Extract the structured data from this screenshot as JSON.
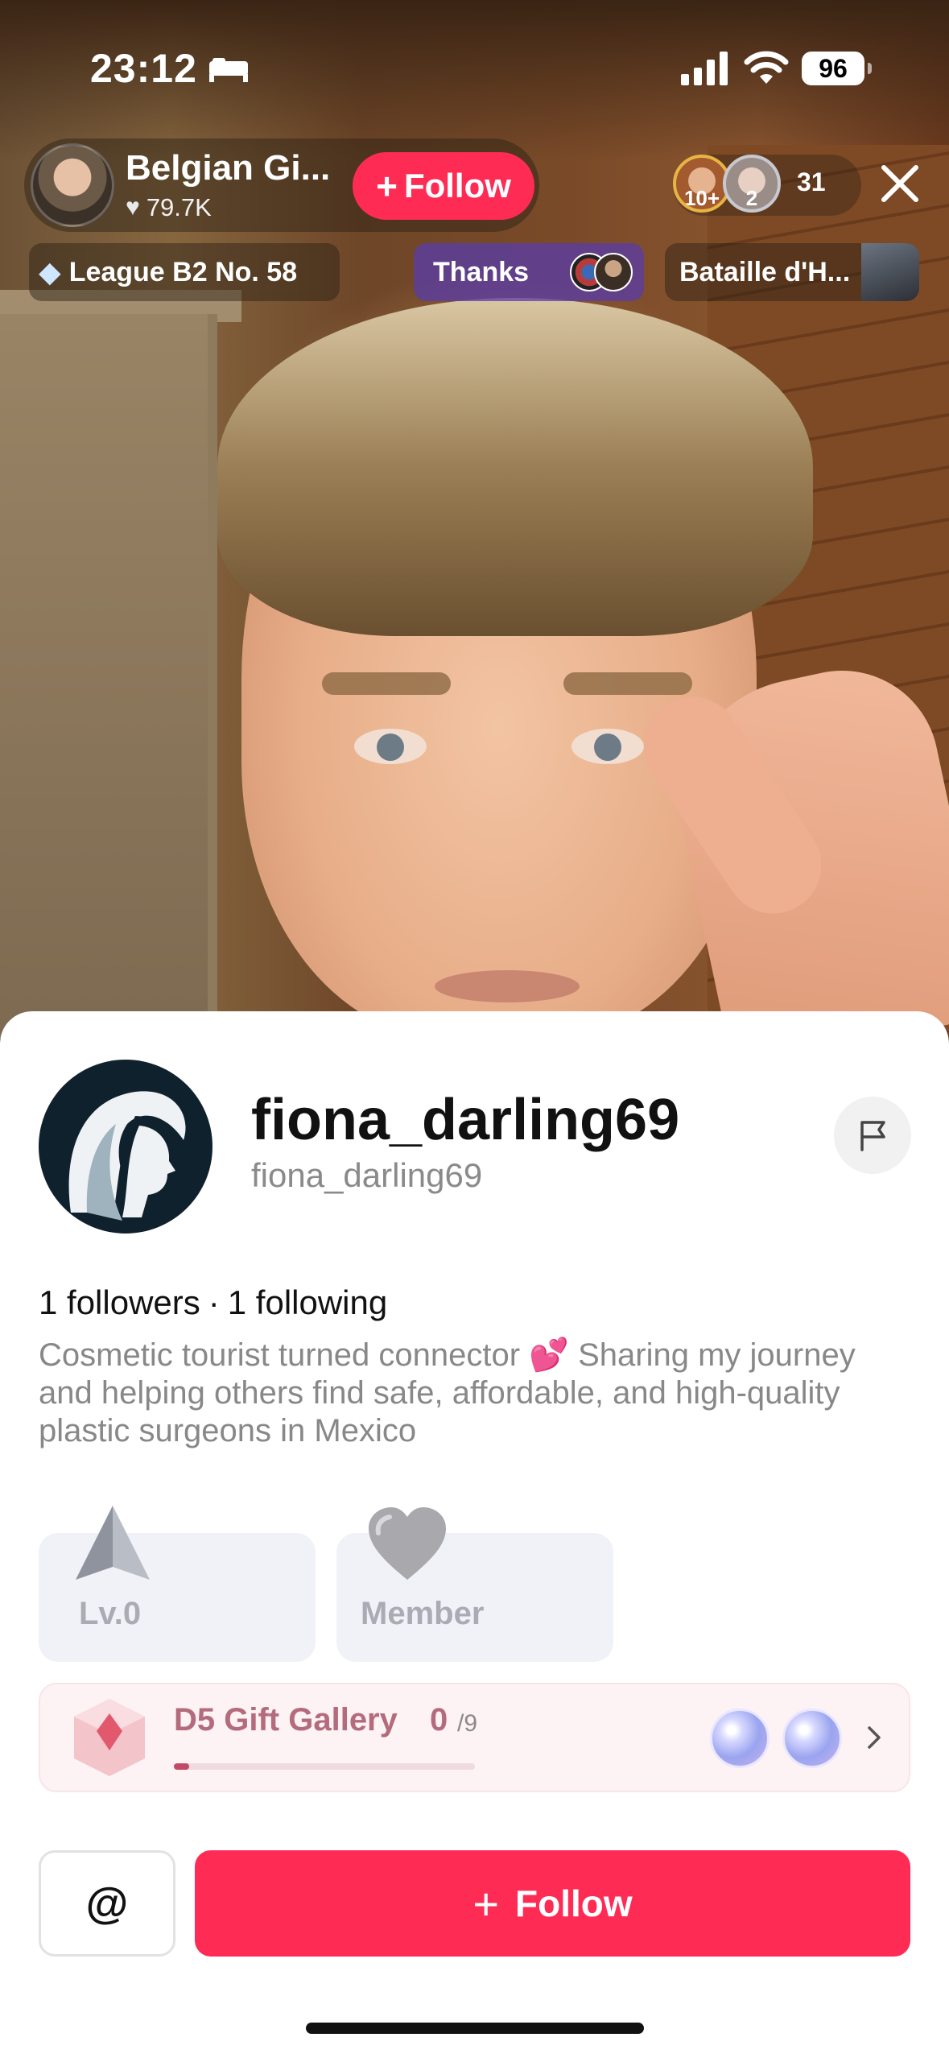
{
  "status_bar": {
    "time": "23:12",
    "battery": "96",
    "icons": [
      "sleep-focus-icon",
      "cellular-signal-icon",
      "wifi-icon",
      "battery-icon"
    ]
  },
  "live": {
    "host_name": "Belgian Gi...",
    "host_likes": "79.7K",
    "follow_label": "Follow",
    "viewer_badges": [
      "10+",
      "2"
    ],
    "viewer_count": "31",
    "league": "League B2 No. 58",
    "thanks": "Thanks",
    "battle": "Bataille d'H..."
  },
  "profile": {
    "username": "fiona_darling69",
    "handle": "fiona_darling69",
    "followers": "1 followers",
    "separator": "·",
    "following": "1 following",
    "bio": "Cosmetic tourist turned connector 💕 Sharing my journey and helping others find safe, affordable, and high-quality plastic surgeons in Mexico",
    "level_label": "Lv.0",
    "member_label": "Member",
    "gallery_title": "D5 Gift Gallery",
    "gallery_count": "0",
    "gallery_total": "/9",
    "gallery_progress": 0.05,
    "mention_label": "@",
    "follow_label": "Follow"
  },
  "colors": {
    "accent": "#fe2c55",
    "gallery_text": "#b46b7c",
    "badge_bg": "#f1f2f7"
  }
}
